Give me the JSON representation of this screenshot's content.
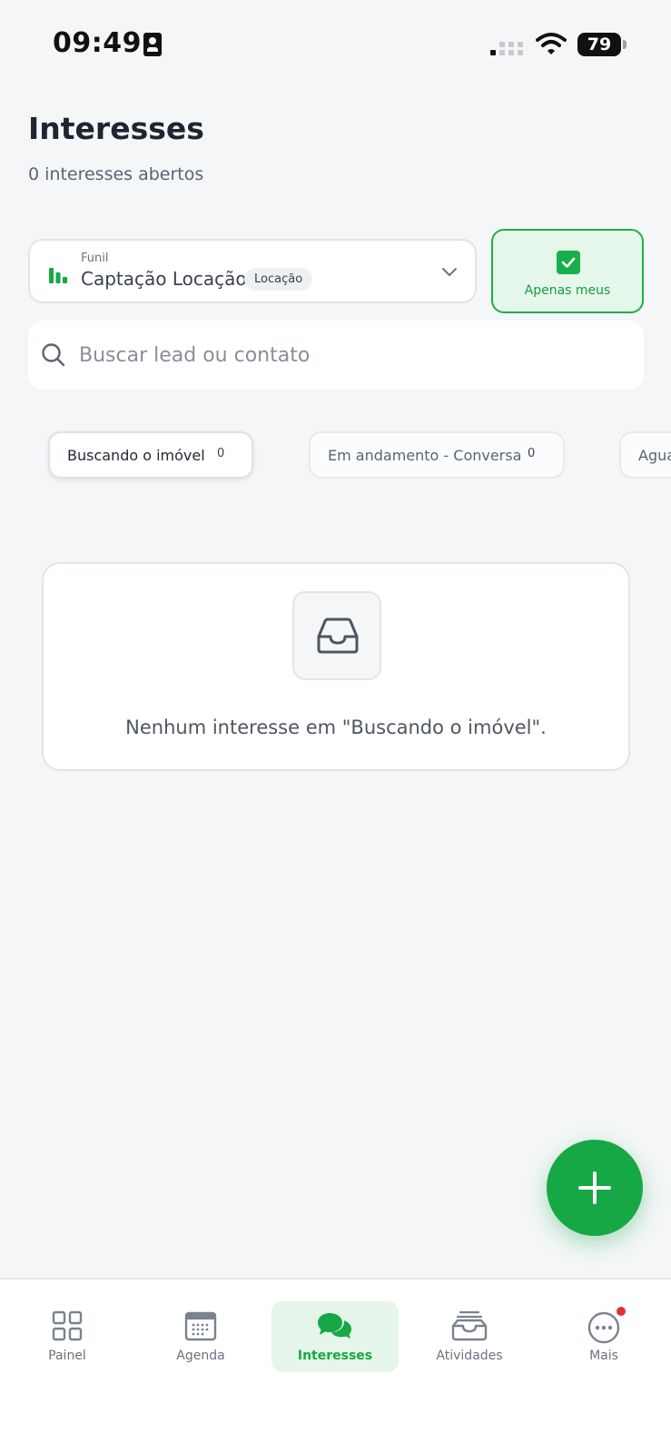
{
  "status_bar": {
    "time": "09:49",
    "battery": "79"
  },
  "header": {
    "title": "Interesses",
    "subtitle": "0 interesses abertos"
  },
  "funnel": {
    "label": "Funil",
    "value": "Captação Locação",
    "badge": "Locação"
  },
  "filter": {
    "only_mine_label": "Apenas meus",
    "only_mine_checked": true
  },
  "search": {
    "placeholder": "Buscar lead ou contato"
  },
  "stages": [
    {
      "label": "Buscando o imóvel",
      "count": "0",
      "active": true
    },
    {
      "label": "Em andamento - Conversa",
      "count": "0",
      "active": false
    },
    {
      "label": "Agua",
      "count": "",
      "active": false
    }
  ],
  "empty_state": {
    "icon": "inbox-icon",
    "message": "Nenhum interesse em \"Buscando o imóvel\"."
  },
  "fab": {
    "icon": "plus-icon"
  },
  "bottom_nav": {
    "items": [
      {
        "label": "Painel",
        "icon": "grid-icon"
      },
      {
        "label": "Agenda",
        "icon": "calendar-icon"
      },
      {
        "label": "Interesses",
        "icon": "chat-bubbles-icon",
        "active": true
      },
      {
        "label": "Atividades",
        "icon": "inbox-tray-icon"
      },
      {
        "label": "Mais",
        "icon": "more-dots-icon",
        "has_notification": true
      }
    ]
  },
  "colors": {
    "accent": "#16a845",
    "accent_light": "#e5f5ea",
    "background": "#f4f6f8",
    "notification": "#e03131"
  }
}
